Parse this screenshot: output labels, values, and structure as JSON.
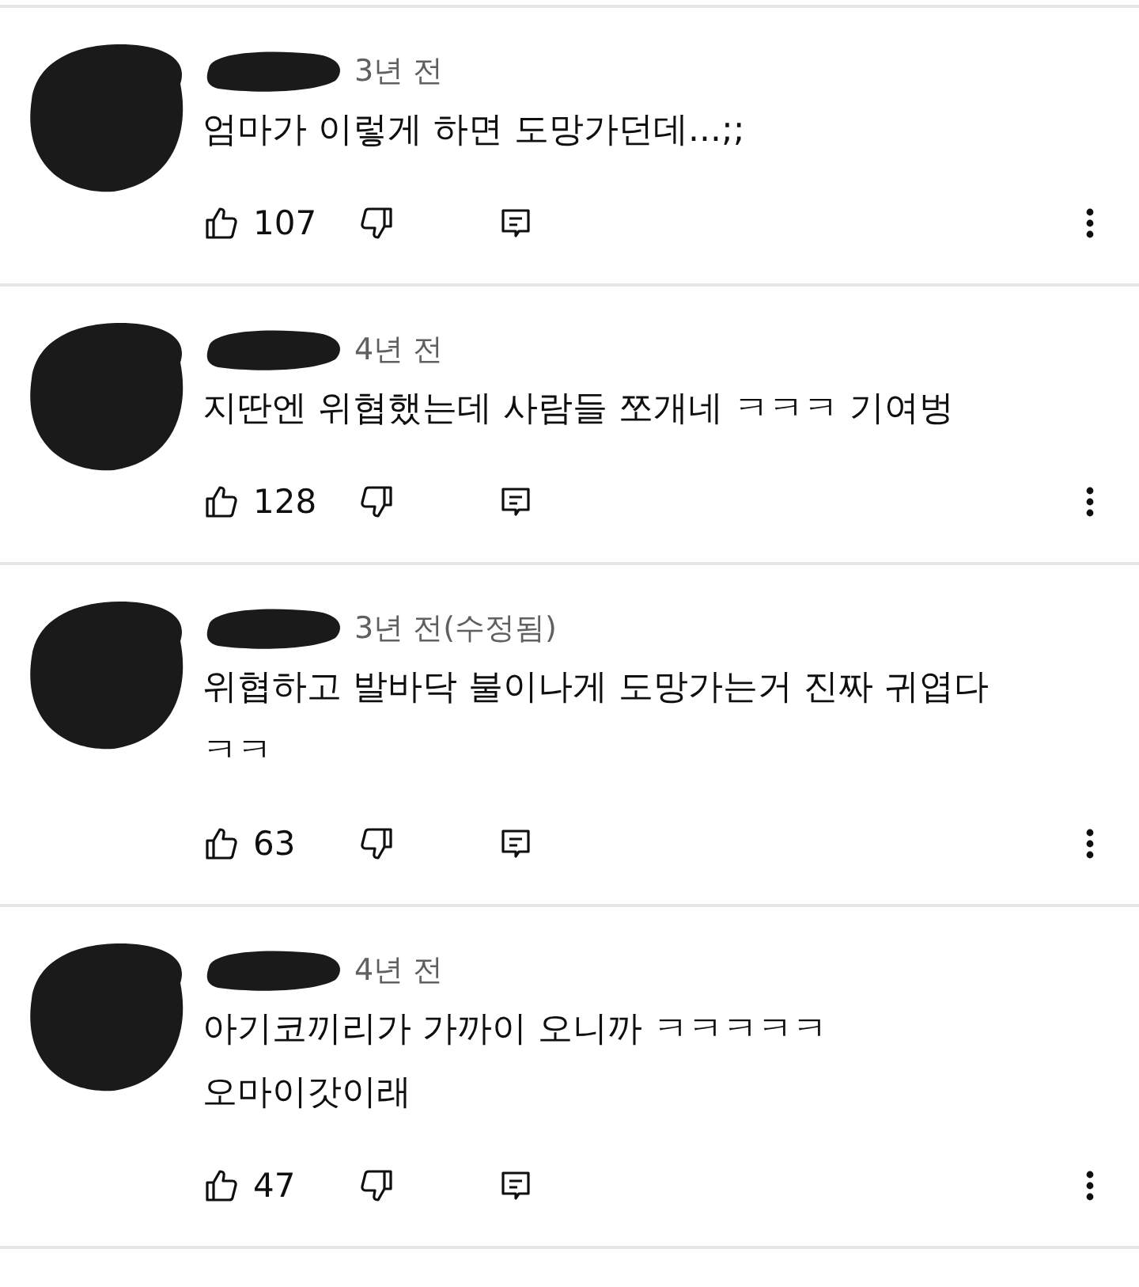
{
  "comments": [
    {
      "time": "3년 전",
      "text": "엄마가 이렇게 하면 도망가던데...;;",
      "likes": "107"
    },
    {
      "time": "4년 전",
      "text": "지딴엔 위협했는데 사람들 쪼개네 ㅋㅋㅋ 기여벙",
      "likes": "128"
    },
    {
      "time": "3년 전(수정됨)",
      "text": "위협하고 발바닥 불이나게 도망가는거 진짜 귀엽다\nㅋㅋ",
      "likes": "63"
    },
    {
      "time": "4년 전",
      "text": "아기코끼리가 가까이 오니까 ㅋㅋㅋㅋㅋ\n오마이갓이래",
      "likes": "47"
    }
  ]
}
